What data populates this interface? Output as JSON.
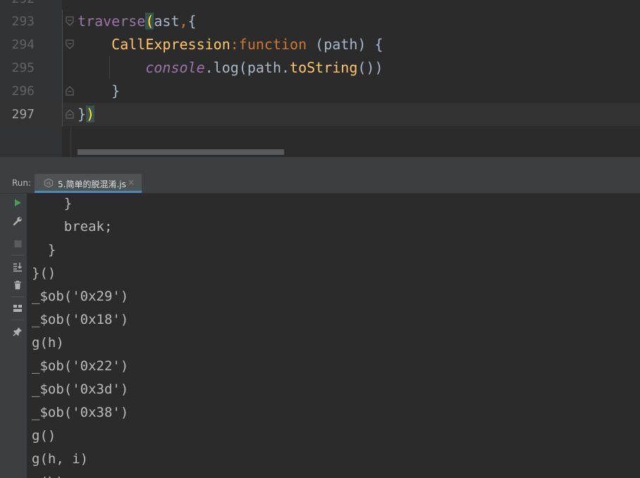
{
  "editor": {
    "partial_line_number": "292",
    "lines": [
      {
        "number": "293",
        "text": "traverse(ast,{"
      },
      {
        "number": "294",
        "text": "    CallExpression:function (path) {"
      },
      {
        "number": "295",
        "text": "        console.log(path.toString())"
      },
      {
        "number": "296",
        "text": "    }"
      },
      {
        "number": "297",
        "text": "})"
      }
    ],
    "tokens": {
      "l293_fn": "traverse",
      "l293_paren": "(",
      "l293_arg": "ast",
      "l293_comma": ",",
      "l293_brace": "{",
      "l294_indent": "    ",
      "l294_key": "CallExpression",
      "l294_colon": ":",
      "l294_kw": "function",
      "l294_rest": " (path) {",
      "l295_indent": "        ",
      "l295_glob": "console",
      "l295_dot": ".log(path.",
      "l295_method": "toString",
      "l295_end": "())",
      "l296_text": "    }",
      "l297_brace": "}",
      "l297_paren": ")"
    },
    "colors": {
      "background": "#2b2b2b",
      "gutter": "#313335",
      "keyword": "#cc7832",
      "function_name": "#9876aa",
      "method": "#ffc66d",
      "matched_paren": "#ffef28"
    }
  },
  "run_panel": {
    "label": "Run:",
    "tab": {
      "label": "5.简单的脱混淆.js",
      "close": "×",
      "icon": "nodejs-file-icon"
    },
    "accent_color": "#4a88c7",
    "toolbar": [
      "rerun-icon",
      "wrench-icon",
      "stop-icon",
      "scroll-to-end-icon",
      "trash-icon",
      "layout-icon",
      "pin-icon"
    ]
  },
  "console": {
    "lines": [
      "    }",
      "    break;",
      "  }",
      "}()",
      "_$ob('0x29')",
      "_$ob('0x18')",
      "g(h)",
      "_$ob('0x22')",
      "_$ob('0x3d')",
      "_$ob('0x38')",
      "g()",
      "g(h, i)",
      "g(h)"
    ]
  }
}
